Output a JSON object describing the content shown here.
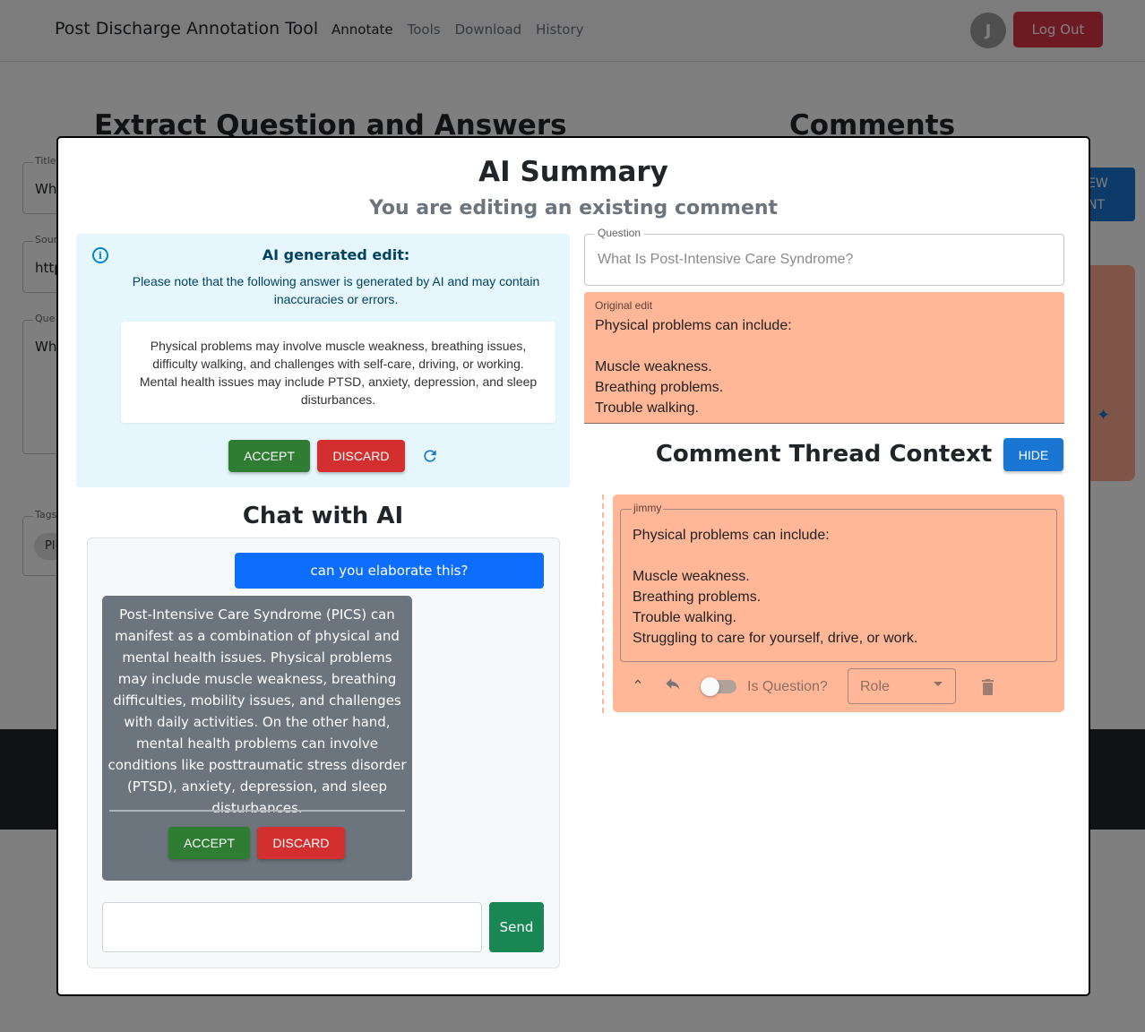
{
  "navbar": {
    "brand": "Post Discharge Annotation Tool",
    "links": [
      "Annotate",
      "Tools",
      "Download",
      "History"
    ],
    "avatar_initial": "J",
    "logout_label": "Log Out"
  },
  "background": {
    "left_heading": "Extract Question and Answers",
    "right_heading": "Comments",
    "fields": [
      {
        "label": "Title",
        "value": "Wh"
      },
      {
        "label": "Sour",
        "value": "http"
      },
      {
        "label": "Que",
        "value": "Wh"
      },
      {
        "label": "Tags",
        "value": "Pl"
      }
    ],
    "new_comment_label": "EW\nNT"
  },
  "modal": {
    "title": "AI Summary",
    "subtitle": "You are editing an existing comment",
    "ai_edit": {
      "title": "AI generated edit:",
      "note": "Please note that the following answer is generated by AI and may contain inaccuracies or errors.",
      "answer": "Physical problems may involve muscle weakness, breathing issues, difficulty walking, and challenges with self-care, driving, or working. Mental health issues may include PTSD, anxiety, depression, and sleep disturbances.",
      "accept_label": "ACCEPT",
      "discard_label": "DISCARD"
    },
    "chat": {
      "title": "Chat with AI",
      "user_message": "can you elaborate this?",
      "ai_message": "Post-Intensive Care Syndrome (PICS) can manifest as a combination of physical and mental health issues. Physical problems may include muscle weakness, breathing difficulties, mobility issues, and challenges with daily activities. On the other hand, mental health problems can involve conditions like posttraumatic stress disorder (PTSD), anxiety, depression, and sleep disturbances.",
      "accept_label": "ACCEPT",
      "discard_label": "DISCARD",
      "input_value": "",
      "send_label": "Send"
    },
    "question": {
      "label": "Question",
      "value": "What Is Post-Intensive Care Syndrome?"
    },
    "original_edit": {
      "label": "Original edit",
      "text": "Physical problems can include:\n\nMuscle weakness.\nBreathing problems.\nTrouble walking."
    },
    "thread": {
      "title": "Comment Thread Context",
      "hide_label": "HIDE",
      "comment": {
        "author": "jimmy",
        "text": "Physical problems can include:\n\nMuscle weakness.\nBreathing problems.\nTrouble walking.\nStruggling to care for yourself, drive, or work.",
        "is_question_label": "Is Question?",
        "is_question": false,
        "role_placeholder": "Role"
      }
    }
  },
  "colors": {
    "comment_bg": "#ffb797",
    "accept": "#2e7d32",
    "discard": "#d32f2f",
    "primary": "#1976d2",
    "send": "#198754",
    "logout": "#dc3545"
  },
  "icons": [
    "info-icon",
    "refresh-icon",
    "chevron-up-icon",
    "reply-icon",
    "trash-icon",
    "magic-wand-icon"
  ]
}
